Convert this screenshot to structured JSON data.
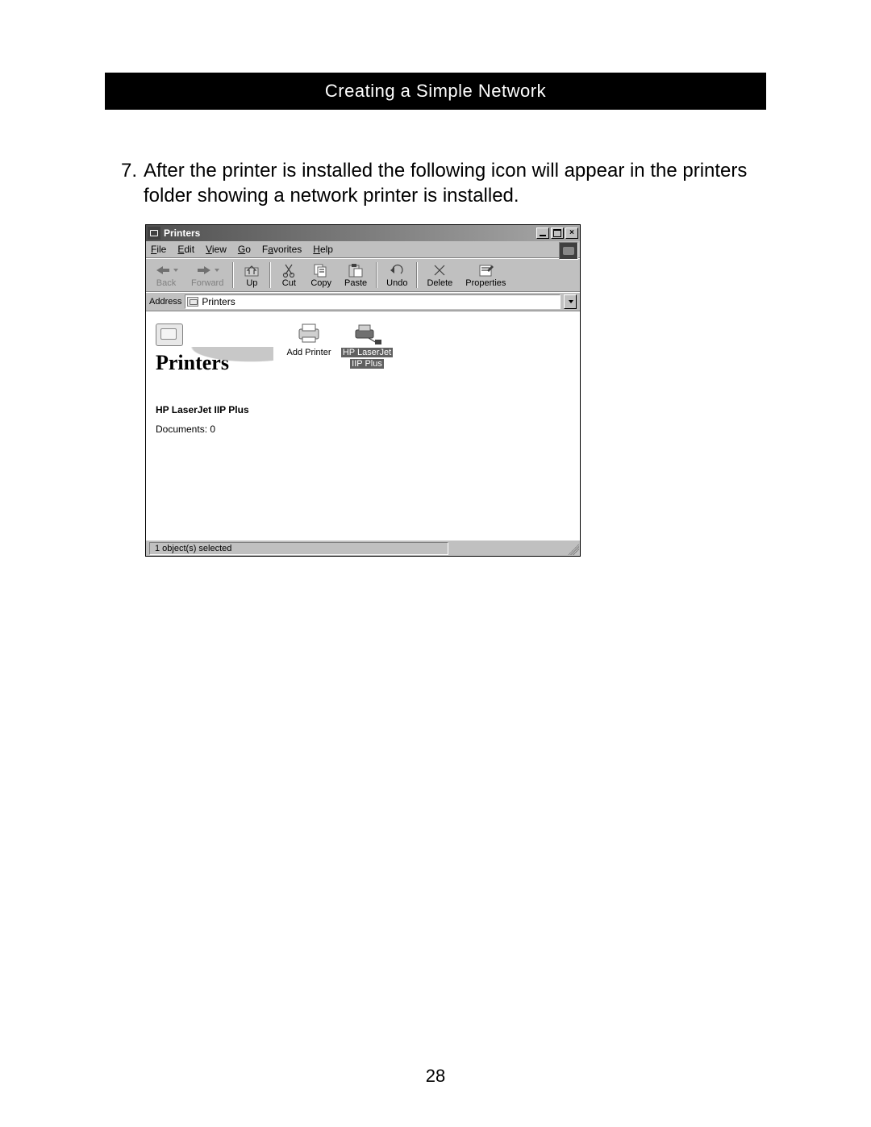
{
  "header": {
    "title": "Creating a Simple Network"
  },
  "step": {
    "number": "7.",
    "text": "After the printer is installed the following icon will appear in the printers folder showing a network printer is installed."
  },
  "window": {
    "title": "Printers",
    "menus": [
      {
        "prefix": "",
        "key": "F",
        "rest": "ile"
      },
      {
        "prefix": "",
        "key": "E",
        "rest": "dit"
      },
      {
        "prefix": "",
        "key": "V",
        "rest": "iew"
      },
      {
        "prefix": "",
        "key": "G",
        "rest": "o"
      },
      {
        "prefix": "F",
        "key": "a",
        "rest": "vorites"
      },
      {
        "prefix": "",
        "key": "H",
        "rest": "elp"
      }
    ],
    "toolbar": {
      "back": "Back",
      "forward": "Forward",
      "up": "Up",
      "cut": "Cut",
      "copy": "Copy",
      "paste": "Paste",
      "undo": "Undo",
      "delete": "Delete",
      "properties": "Properties"
    },
    "address": {
      "label": "Address",
      "value": "Printers"
    },
    "sidepanel": {
      "heading": "Printers",
      "selected_name": "HP LaserJet IIP Plus",
      "documents": "Documents: 0"
    },
    "icons": {
      "add_printer": "Add Printer",
      "hp_laserjet_line1": "HP LaserJet",
      "hp_laserjet_line2": "IIP Plus"
    },
    "statusbar": "1 object(s) selected"
  },
  "page_number": "28"
}
